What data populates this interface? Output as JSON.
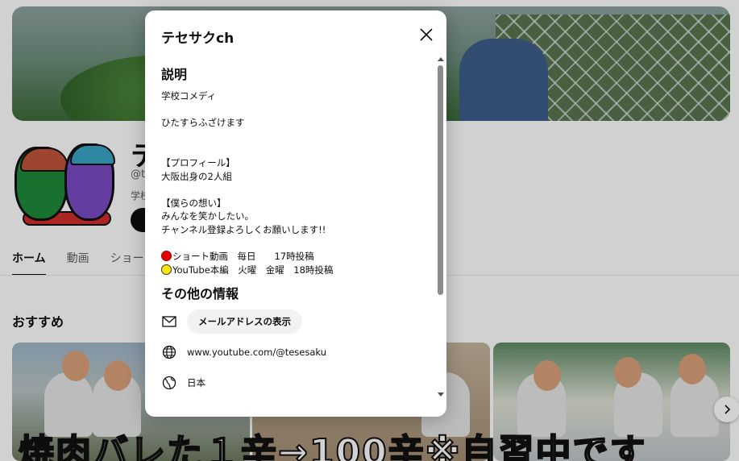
{
  "background": {
    "channel_title": "テ",
    "channel_handle": "@te",
    "channel_desc": "学校",
    "tabs": [
      {
        "label": "ホーム"
      },
      {
        "label": "動画"
      },
      {
        "label": "ショー"
      }
    ],
    "section_title": "おすすめ",
    "thumb_caption": "焼肉バレた１辛→100辛※自習中です",
    "next_icon": "chevron-right-icon"
  },
  "dialog": {
    "title": "テセサクch",
    "close_icon": "close-icon",
    "description_heading": "説明",
    "description_lines": [
      "学校コメディ",
      "",
      "ひたすらふざけます",
      "",
      "",
      "【プロフィール】",
      "大阪出身の2人組",
      "",
      "【僕らの想い】",
      "みんなを笑かしたい。",
      "チャンネル登録よろしくお願いします!!",
      ""
    ],
    "schedule": [
      {
        "dot_color": "#e00000",
        "text": "ショート動画　毎日　　17時投稿"
      },
      {
        "dot_color": "#ffe500",
        "text": "YouTube本編　火曜　金曜　18時投稿"
      }
    ],
    "other_heading": "その他の情報",
    "email_button_label": "メールアドレスの表示",
    "website": "www.youtube.com/@tesesaku",
    "country": "日本",
    "icons": {
      "email": "mail-icon",
      "website": "globe-icon",
      "country": "globe-location-icon"
    }
  }
}
